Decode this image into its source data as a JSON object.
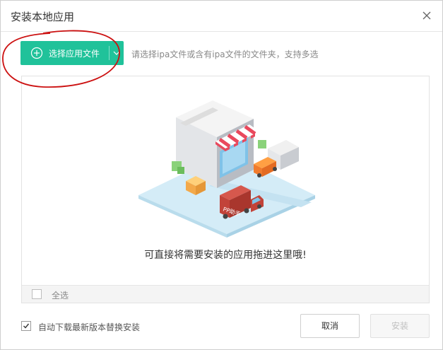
{
  "window": {
    "title": "安装本地应用"
  },
  "toolbar": {
    "select_button_label": "选择应用文件",
    "hint": "请选择ipa文件或含有ipa文件的文件夹，支持多选"
  },
  "drop_zone": {
    "message": "可直接将需要安装的应用拖进这里哦!",
    "select_all_label": "全选"
  },
  "footer": {
    "auto_update_label": "自动下载最新版本替换安装",
    "auto_update_checked": true,
    "cancel_label": "取消",
    "install_label": "安装"
  },
  "illustration": {
    "truck_text": "PP助手"
  },
  "colors": {
    "accent": "#20c29a",
    "annotation": "#cc1111"
  }
}
